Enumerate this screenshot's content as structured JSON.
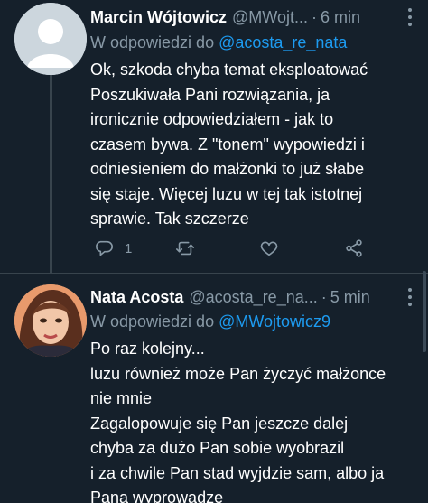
{
  "tweets": [
    {
      "display_name": "Marcin Wójtowicz",
      "handle": "@MWojt...",
      "time": "6 min",
      "reply_prefix": "W odpowiedzi do ",
      "reply_to": "@acosta_re_nata",
      "lines": [
        "Ok, szkoda chyba temat eksploatować",
        "Poszukiwała Pani rozwiązania, ja",
        "ironicznie odpowiedziałem - jak to",
        "czasem bywa. Z \"tonem\" wypowiedzi i",
        "odniesieniem do małżonki to już słabe",
        "się staje. Więcej luzu w tej tak istotnej",
        "sprawie. Tak szczerze"
      ],
      "reply_count": "1",
      "icons": [
        "reply-icon",
        "retweet-icon",
        "like-icon",
        "share-icon"
      ]
    },
    {
      "display_name": "Nata Acosta",
      "handle": "@acosta_re_na...",
      "time": "5 min",
      "reply_prefix": "W odpowiedzi do ",
      "reply_to": "@MWojtowicz9",
      "lines": [
        "Po raz kolejny...",
        "luzu również może Pan życzyć małżonce",
        "nie mnie",
        "Zagalopowuje się Pan jeszcze dalej",
        "chyba za dużo Pan sobie wyobrazil",
        "i za chwile Pan stad wyjdzie sam, albo ja",
        "Pana wyprowadzę"
      ]
    }
  ],
  "separator": "·",
  "colors": {
    "background": "#15202b",
    "secondary_text": "#8899a6",
    "accent": "#1d9bf0",
    "divider": "#38444d"
  }
}
